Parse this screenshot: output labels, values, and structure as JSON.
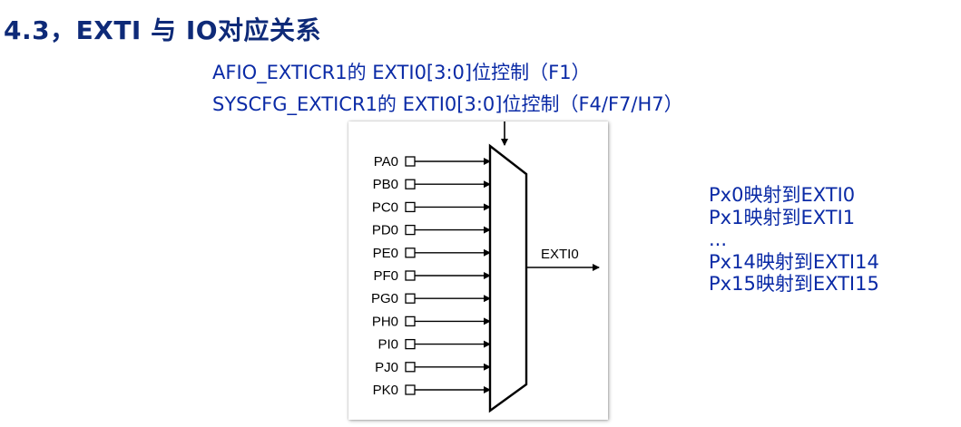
{
  "title": "4.3，EXTI 与 IO对应关系",
  "subtitle_lines": [
    "AFIO_EXTICR1的 EXTI0[3:0]位控制（F1）",
    "SYSCFG_EXTICR1的 EXTI0[3:0]位控制（F4/F7/H7）"
  ],
  "diagram": {
    "inputs": [
      "PA0",
      "PB0",
      "PC0",
      "PD0",
      "PE0",
      "PF0",
      "PG0",
      "PH0",
      "PI0",
      "PJ0",
      "PK0"
    ],
    "output": "EXTI0"
  },
  "mapping_lines": [
    "Px0映射到EXTI0",
    "Px1映射到EXTI1",
    "...",
    "Px14映射到EXTI14",
    "Px15映射到EXTI15"
  ]
}
